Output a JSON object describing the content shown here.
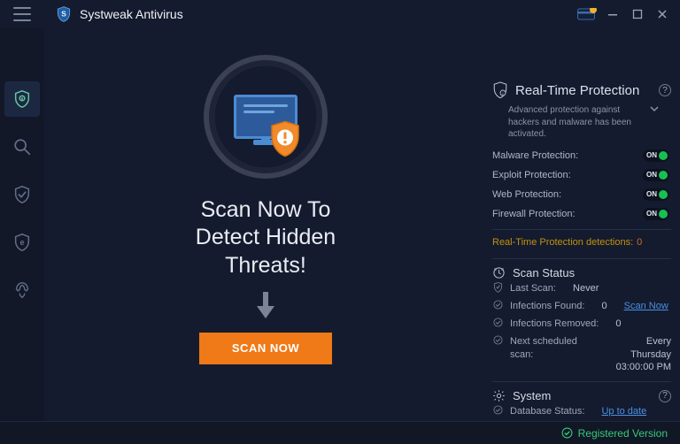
{
  "titlebar": {
    "app_name": "Systweak Antivirus"
  },
  "sidebar": {
    "items": [
      {
        "name": "home-shield",
        "active": true
      },
      {
        "name": "scan-search",
        "active": false
      },
      {
        "name": "quarantine-shield",
        "active": false
      },
      {
        "name": "browser-shield",
        "active": false
      },
      {
        "name": "optimizer-rocket",
        "active": false
      }
    ]
  },
  "hero": {
    "headline": "Scan Now To\nDetect Hidden\nThreats!",
    "scan_button": "SCAN NOW"
  },
  "realtime": {
    "title": "Real-Time Protection",
    "description": "Advanced protection against hackers and malware has been activated.",
    "items": [
      {
        "label": "Malware Protection:",
        "state": "ON"
      },
      {
        "label": "Exploit Protection:",
        "state": "ON"
      },
      {
        "label": "Web Protection:",
        "state": "ON"
      },
      {
        "label": "Firewall Protection:",
        "state": "ON"
      }
    ],
    "detections_label": "Real-Time Protection detections:",
    "detections_count": "0"
  },
  "scan_status": {
    "title": "Scan Status",
    "last_scan_label": "Last Scan:",
    "last_scan_value": "Never",
    "infections_found_label": "Infections Found:",
    "infections_found_value": "0",
    "scan_now_link": "Scan Now",
    "infections_removed_label": "Infections Removed:",
    "infections_removed_value": "0",
    "next_scan_label": "Next scheduled scan:",
    "next_scan_value": "Every Thursday",
    "next_scan_time": "03:00:00 PM"
  },
  "system": {
    "title": "System",
    "db_status_label": "Database Status:",
    "db_status_value": "Up to date"
  },
  "footer": {
    "registered": "Registered Version"
  },
  "colors": {
    "accent_orange": "#ef7a17",
    "accent_green": "#16c052",
    "link_blue": "#4a90e2",
    "warning_amber": "#c2910f",
    "bg": "#141b2e"
  }
}
